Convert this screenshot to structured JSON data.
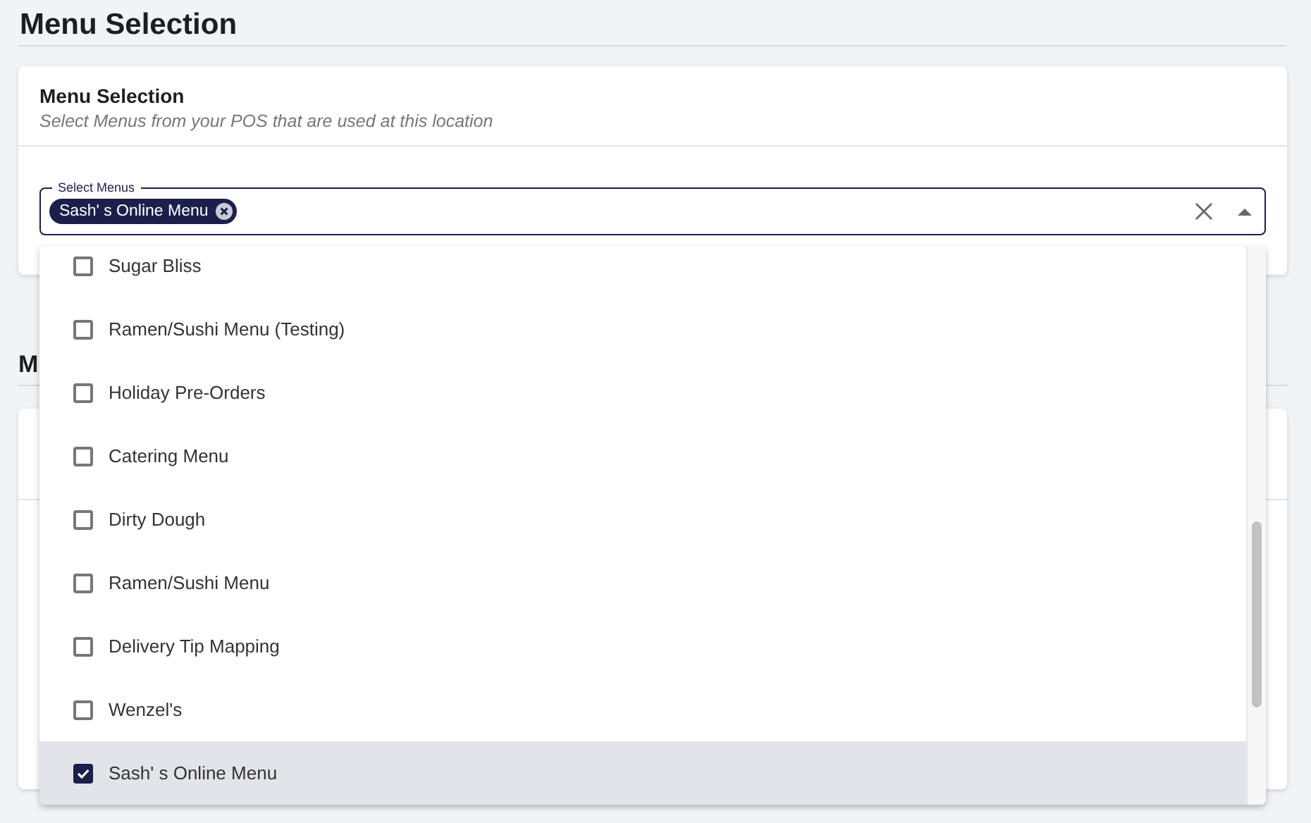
{
  "page_title": "Menu Selection",
  "card": {
    "title": "Menu Selection",
    "subtitle": "Select Menus from your POS that are used at this location"
  },
  "select": {
    "label": "Select Menus",
    "chips": [
      "Sash' s Online Menu"
    ],
    "expanded": true
  },
  "options": [
    {
      "label": "Sugar Bliss",
      "checked": false
    },
    {
      "label": "Ramen/Sushi Menu (Testing)",
      "checked": false
    },
    {
      "label": "Holiday Pre-Orders",
      "checked": false
    },
    {
      "label": "Catering Menu",
      "checked": false
    },
    {
      "label": "Dirty Dough",
      "checked": false
    },
    {
      "label": "Ramen/Sushi Menu",
      "checked": false
    },
    {
      "label": "Delivery Tip Mapping",
      "checked": false
    },
    {
      "label": "Wenzel's",
      "checked": false
    },
    {
      "label": "Sash' s Online Menu",
      "checked": true
    }
  ],
  "second_section": {
    "title": "M"
  }
}
